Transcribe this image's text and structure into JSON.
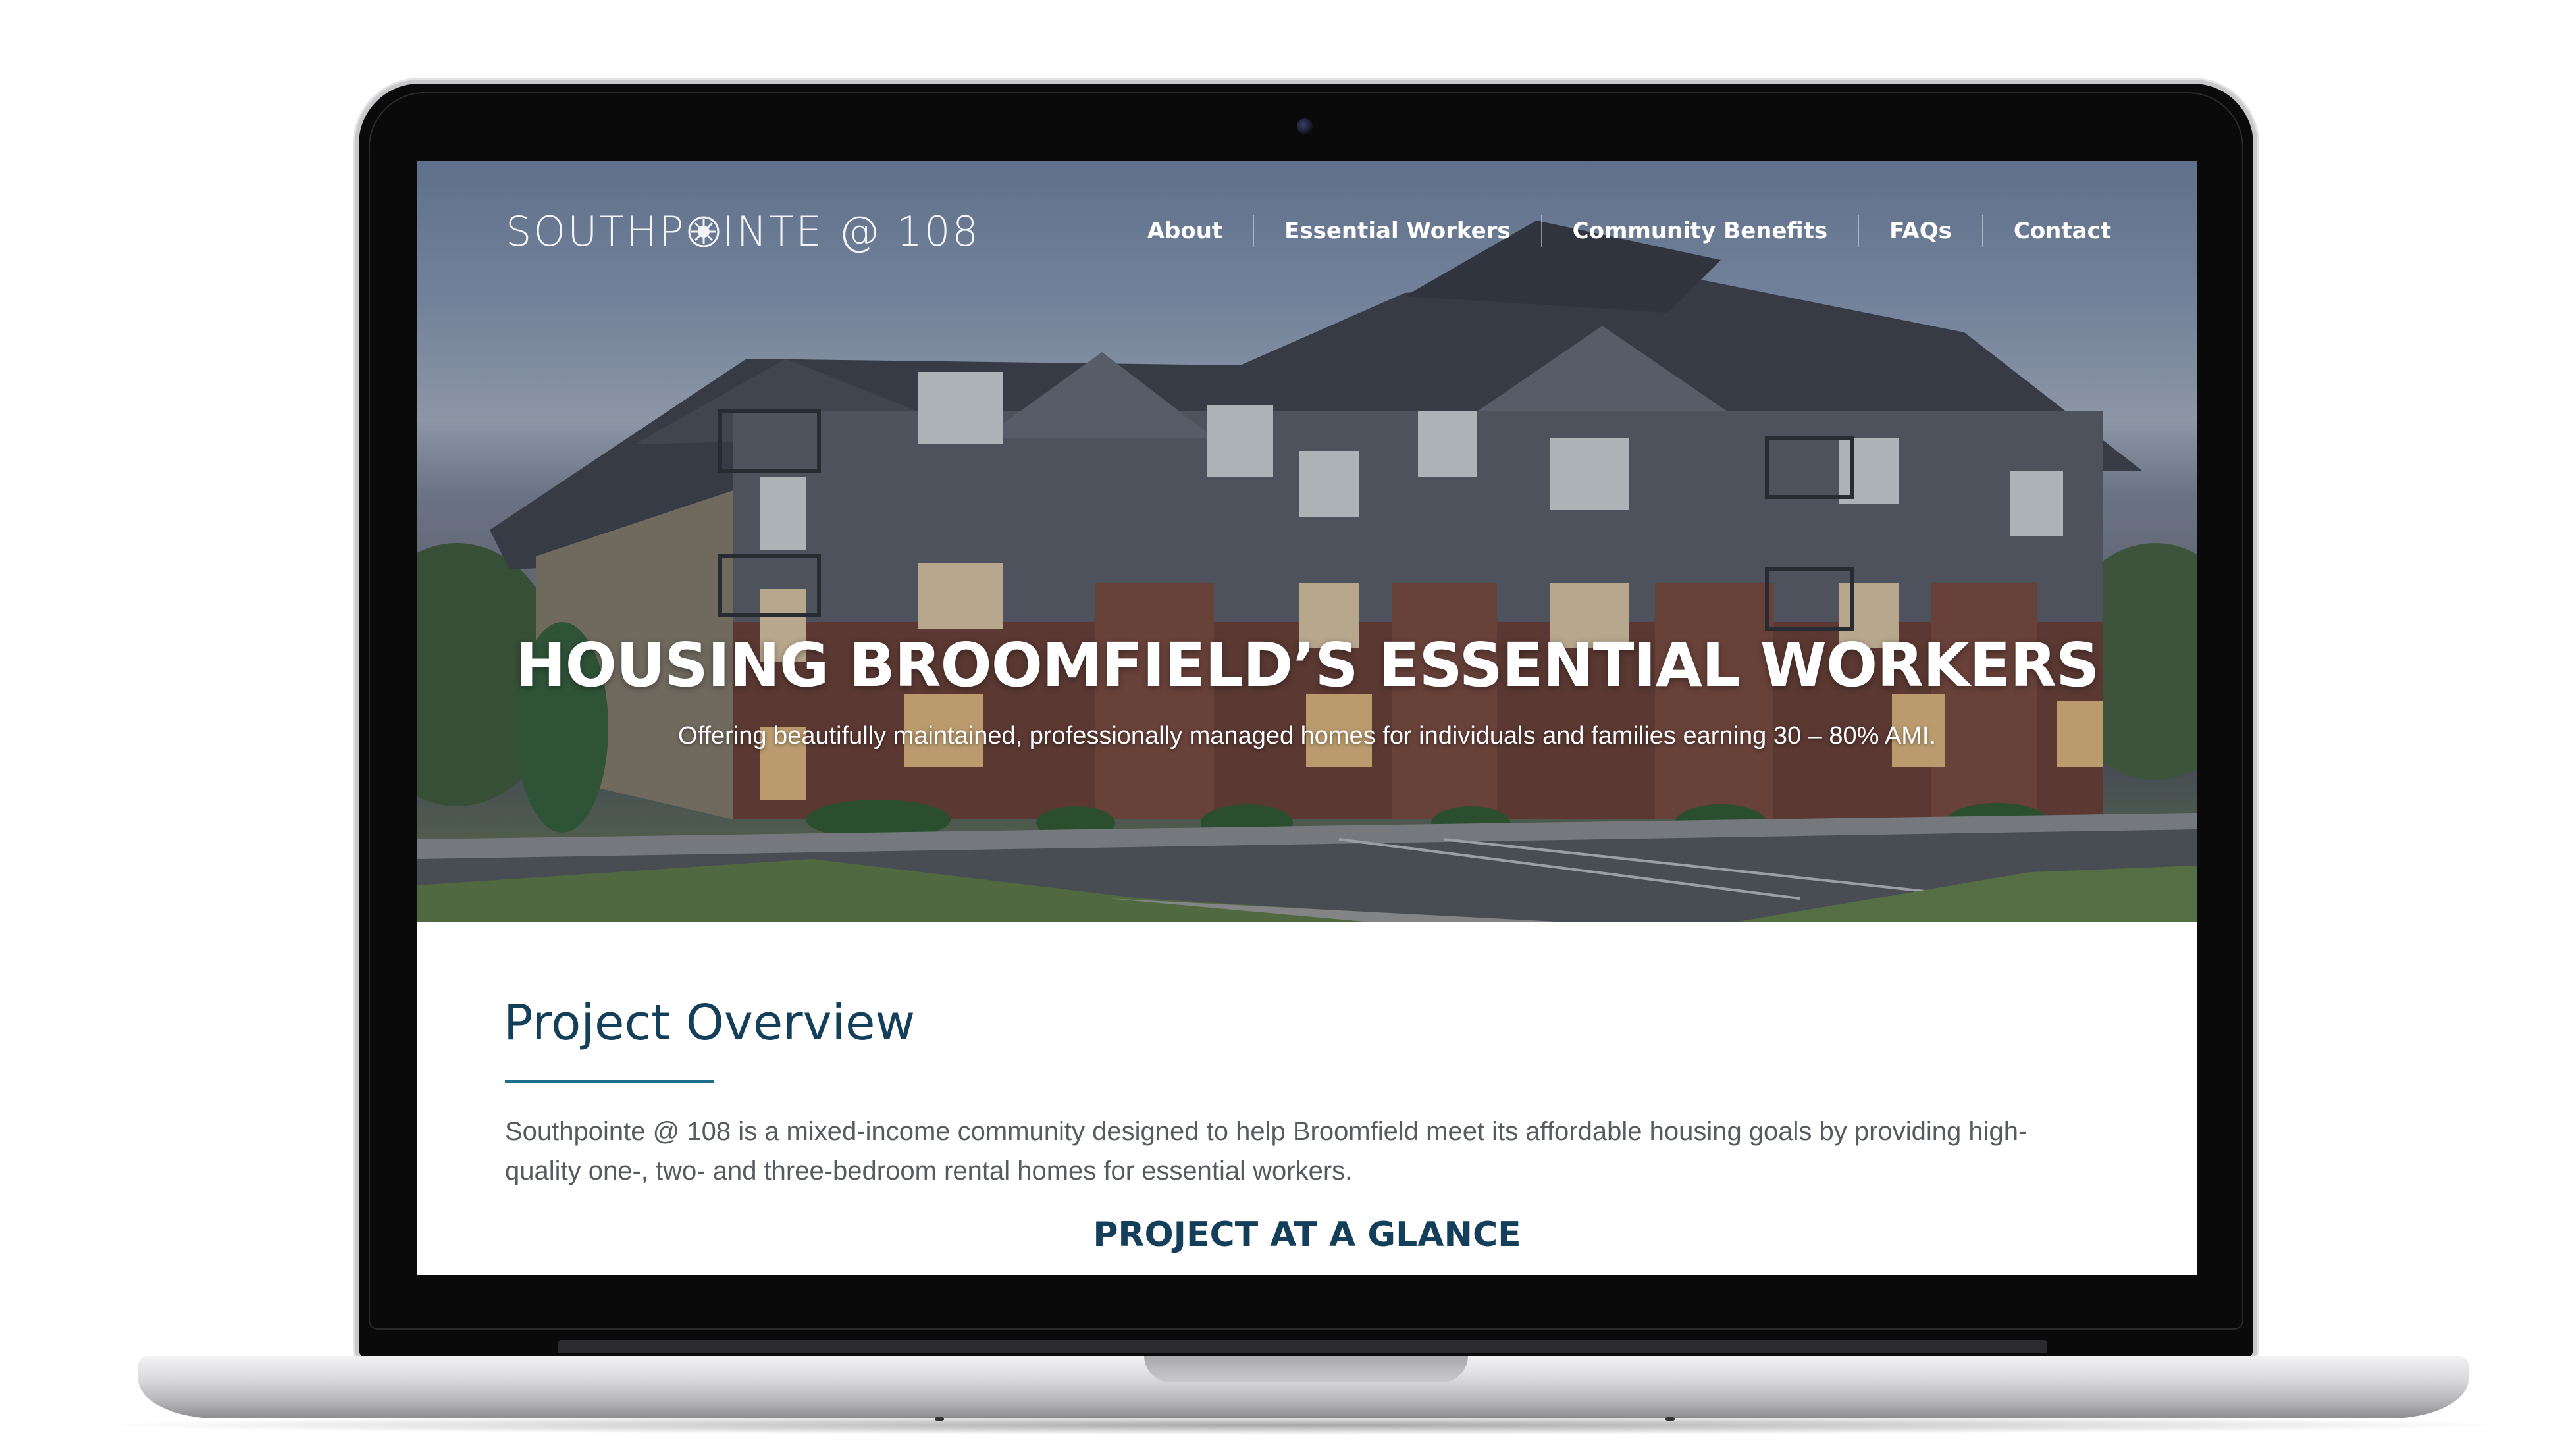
{
  "header": {
    "logo": {
      "left": "SOUTHP",
      "right": "INTE @ 108",
      "icon": "compass-rose-icon"
    },
    "nav": [
      {
        "label": "About"
      },
      {
        "label": "Essential Workers"
      },
      {
        "label": "Community Benefits"
      },
      {
        "label": "FAQs"
      },
      {
        "label": "Contact"
      }
    ]
  },
  "hero": {
    "title": "HOUSING BROOMFIELD’S ESSENTIAL WORKERS",
    "subtitle": "Offering beautifully maintained, professionally managed homes for individuals and families earning 30 – 80% AMI."
  },
  "overview": {
    "heading": "Project Overview",
    "text": "Southpointe @ 108 is a mixed-income community designed to help Broomfield meet its affordable housing goals by providing high-quality one-, two- and three-bedroom rental homes for essential workers.",
    "glance_heading": "PROJECT AT A GLANCE"
  },
  "colors": {
    "heading": "#133f5a",
    "accent_rule": "#1f6f8b",
    "body_text": "#575b60"
  }
}
